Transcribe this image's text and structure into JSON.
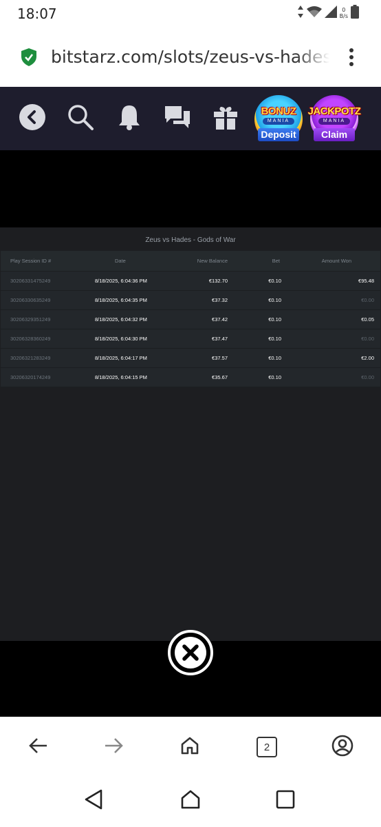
{
  "status_bar": {
    "time": "18:07",
    "net_speed_value": "0",
    "net_speed_unit": "B/s",
    "icons": [
      "data-arrows-icon",
      "wifi-icon",
      "signal-icon",
      "battery-icon"
    ]
  },
  "browser": {
    "url": "bitstarz.com/slots/zeus-vs-hades-gods-of-war",
    "tab_count": "2",
    "security_color": "#1e8e3e"
  },
  "site_nav": {
    "icons": [
      "back-icon",
      "search-icon",
      "bell-icon",
      "chat-icon",
      "gift-icon"
    ],
    "bonuz": {
      "title": "BONUZ",
      "subtitle": "MANIA",
      "label": "Deposit"
    },
    "jackpotz": {
      "title": "JACKPOTZ",
      "subtitle": "MANIA",
      "label": "Claim"
    }
  },
  "history": {
    "title": "Zeus vs Hades - Gods of War",
    "columns": {
      "id": "Play Session ID #",
      "date": "Date",
      "balance": "New Balance",
      "bet": "Bet",
      "won": "Amount Won"
    },
    "rows": [
      {
        "id": "30206331475249",
        "date": "8/18/2025, 6:04:36 PM",
        "balance": "€132.70",
        "bet": "€0.10",
        "won": "€95.48"
      },
      {
        "id": "30206330635249",
        "date": "8/18/2025, 6:04:35 PM",
        "balance": "€37.32",
        "bet": "€0.10",
        "won": "€0.00"
      },
      {
        "id": "30206329351249",
        "date": "8/18/2025, 6:04:32 PM",
        "balance": "€37.42",
        "bet": "€0.10",
        "won": "€0.05"
      },
      {
        "id": "30206328360249",
        "date": "8/18/2025, 6:04:30 PM",
        "balance": "€37.47",
        "bet": "€0.10",
        "won": "€0.00"
      },
      {
        "id": "30206321283249",
        "date": "8/18/2025, 6:04:17 PM",
        "balance": "€37.57",
        "bet": "€0.10",
        "won": "€2.00"
      },
      {
        "id": "30206320174249",
        "date": "8/18/2025, 6:04:15 PM",
        "balance": "€35.67",
        "bet": "€0.10",
        "won": "€0.00"
      }
    ]
  },
  "colors": {
    "nav_bg": "#1e1d2d",
    "modal_bg": "#1d1e21",
    "row_bg": "#23272b"
  }
}
